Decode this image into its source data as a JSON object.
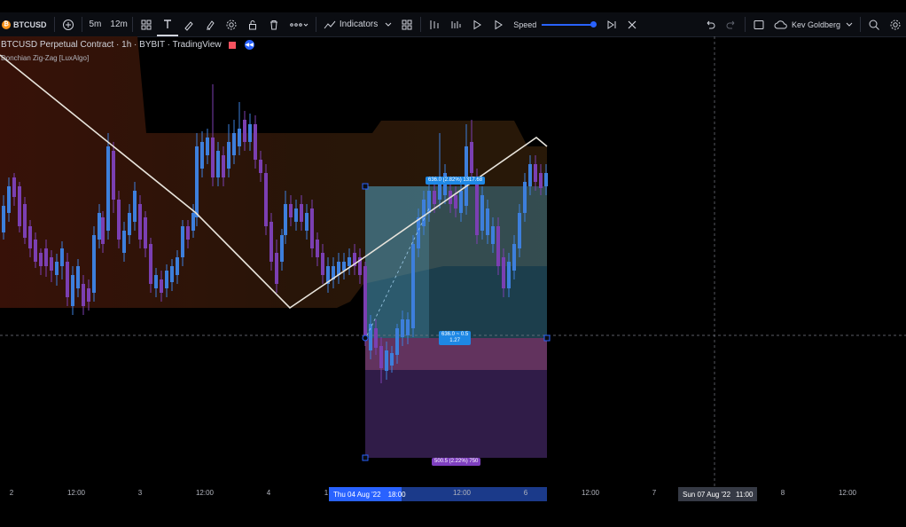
{
  "toolbar": {
    "symbol": "BTCUSD",
    "intervals": [
      "5m",
      "12m"
    ],
    "indicators_label": "Indicators",
    "speed_label": "Speed",
    "speed_value": 1.0,
    "user_name": "Kev Goldberg"
  },
  "legend": {
    "title": "BTCUSD Perpetual Contract · 1h · BYBIT · TradingView",
    "indicator": "Donchian Zig-Zag [LuxAlgo]"
  },
  "position": {
    "target_label": "636.0 (2.82%) 1317.68",
    "center_label_1": "636.0 ~ 0.5",
    "center_label_2": "1.27",
    "stop_label": "500.5 (2.22%) 750"
  },
  "time_axis": {
    "ticks": [
      "2",
      "12:00",
      "3",
      "12:00",
      "4",
      "1",
      "12:00",
      "6",
      "12:00",
      "7",
      "8",
      "12:00"
    ],
    "highlight_start": "Thu 04 Aug '22",
    "highlight_start_time": "18:00",
    "crosshair_label": "Sun 07 Aug '22",
    "crosshair_time": "11:00"
  },
  "colors": {
    "bull": "#3d7fdc",
    "bear": "#7b3fb2",
    "accent": "#2962ff",
    "target_fill": "#4aa3c8",
    "stop_fill": "#6a3fa0"
  }
}
